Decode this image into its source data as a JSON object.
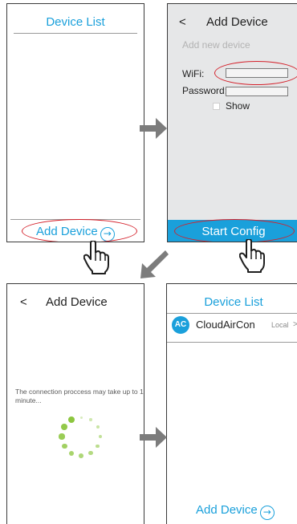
{
  "screen1": {
    "title": "Device List",
    "add_device": "Add Device"
  },
  "screen2": {
    "back": "<",
    "title": "Add Device",
    "placeholder": "Add new device",
    "wifi_label": "WiFi:",
    "password_label": "Password:",
    "show_label": "Show",
    "start_button": "Start Config"
  },
  "screen3": {
    "back": "<",
    "title": "Add Device",
    "message": "The connection proccess may take up to 1 minute..."
  },
  "screen4": {
    "title": "Device List",
    "device_icon": "AC",
    "device_name": "CloudAirCon",
    "device_status": "Local",
    "chevron": ">",
    "add_device": "Add Device"
  },
  "colors": {
    "accent": "#1aa0db",
    "highlight": "#d4202a",
    "spinner": "#8cc63f",
    "arrow": "#7c7c7c"
  },
  "icons": [
    "arrow-right-circle-icon",
    "hand-pointer-icon",
    "arrow-right-icon",
    "arrow-down-left-icon",
    "loading-spinner-icon"
  ]
}
